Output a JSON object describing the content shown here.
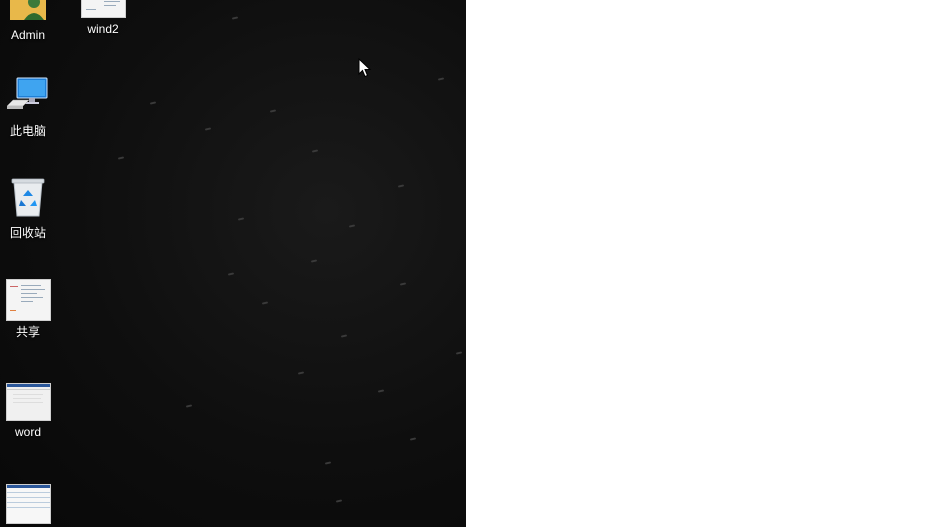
{
  "desktop": {
    "icons": [
      {
        "label": "Admin",
        "icon": "user-folder-icon"
      },
      {
        "label": "wind2",
        "icon": "document-thumbnail-icon"
      },
      {
        "label": "此电脑",
        "icon": "computer-icon"
      },
      {
        "label": "回收站",
        "icon": "recycle-bin-icon"
      },
      {
        "label": "共享",
        "icon": "shared-folder-thumbnail-icon"
      },
      {
        "label": "word",
        "icon": "word-thumbnail-icon"
      },
      {
        "label": "",
        "icon": "spreadsheet-thumbnail-icon"
      }
    ]
  },
  "colors": {
    "desktop_background": "#0e0e0e",
    "right_area": "#ffffff",
    "icon_text": "#ffffff"
  }
}
